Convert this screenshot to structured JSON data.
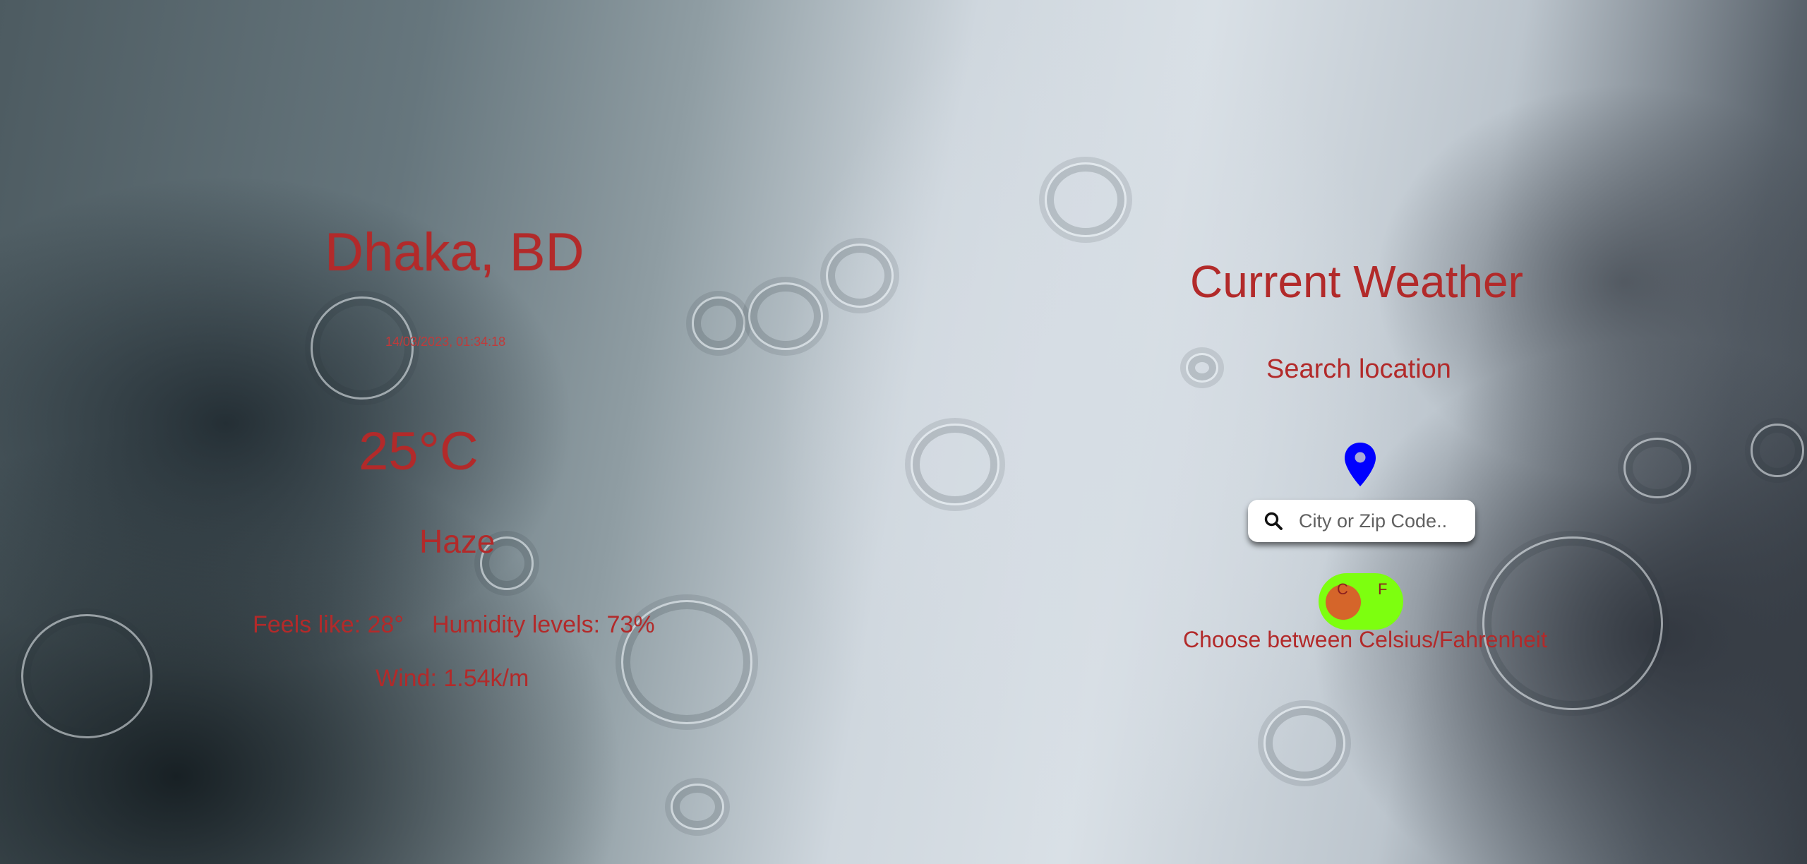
{
  "location": {
    "city": "Dhaka, BD",
    "datetime": "14/03/2023, 01:34:18"
  },
  "weather": {
    "temperature": "25°C",
    "condition": "Haze",
    "feels_like": "Feels like: 28°",
    "humidity": "Humidity levels: 73%",
    "wind": "Wind: 1.54k/m"
  },
  "panel": {
    "title": "Current Weather",
    "search_label": "Search location",
    "search_placeholder": "City or Zip Code..",
    "search_value": "",
    "toggle": {
      "c_label": "C",
      "f_label": "F",
      "selected": "C",
      "caption": "Choose between Celsius/Fahrenheit"
    }
  },
  "colors": {
    "text_accent": "#b22a2a",
    "toggle_track": "#7dff0f",
    "toggle_knob": "#d5652a",
    "pin": "#0000ff"
  },
  "icons": {
    "location": "map-pin-icon",
    "search": "search-icon"
  }
}
